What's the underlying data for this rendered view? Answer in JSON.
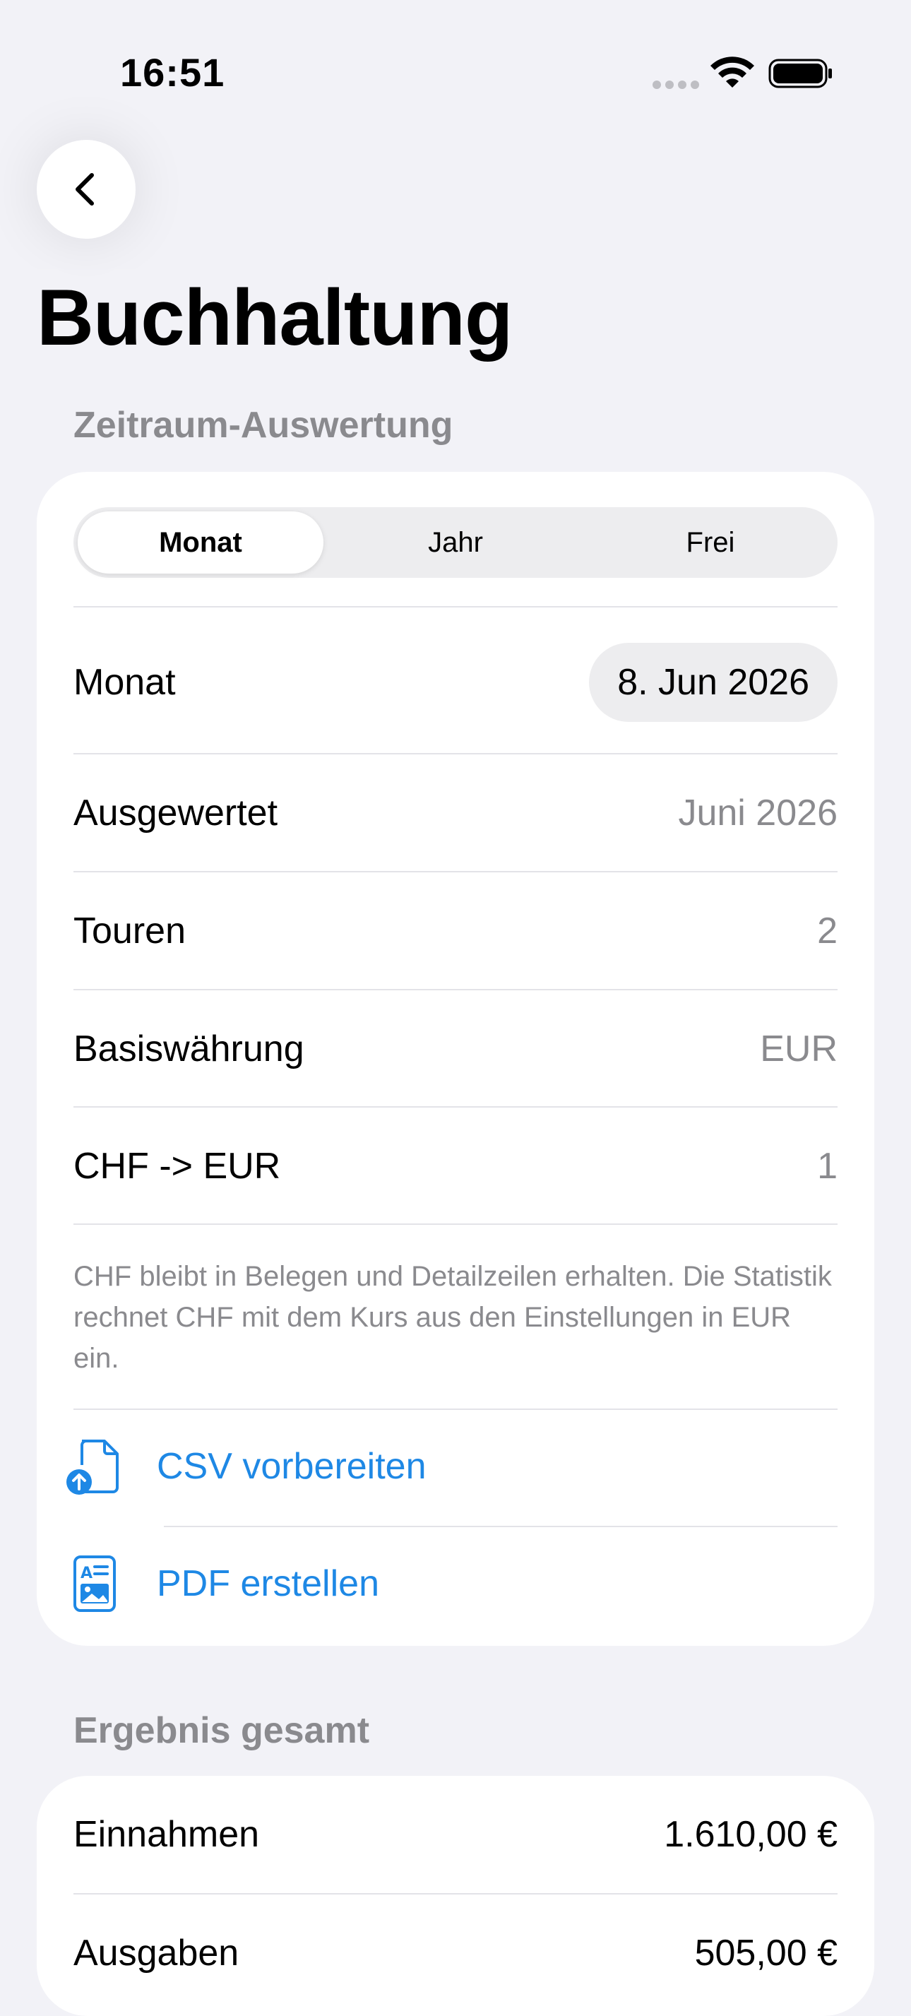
{
  "status_bar": {
    "time": "16:51"
  },
  "nav": {
    "title": "Buchhaltung"
  },
  "period_section": {
    "header": "Zeitraum-Auswertung",
    "segments": [
      "Monat",
      "Jahr",
      "Frei"
    ],
    "selected_segment": "Monat",
    "rows": {
      "month_label": "Monat",
      "month_value": "8. Jun 2026",
      "evaluated_label": "Ausgewertet",
      "evaluated_value": "Juni 2026",
      "tours_label": "Touren",
      "tours_value": "2",
      "base_currency_label": "Basiswährung",
      "base_currency_value": "EUR",
      "rate_label": "CHF -> EUR",
      "rate_value": "1"
    },
    "note": "CHF bleibt in Belegen und Detailzeilen erhalten. Die Statistik rechnet CHF mit dem Kurs aus den Einstellungen in EUR ein.",
    "actions": {
      "csv_label": "CSV vorbereiten",
      "pdf_label": "PDF erstellen"
    }
  },
  "result_section": {
    "header": "Ergebnis gesamt",
    "income_label": "Einnahmen",
    "income_value": "1.610,00 €",
    "expenses_label": "Ausgaben",
    "expenses_value": "505,00 €"
  },
  "colors": {
    "background": "#F2F2F7",
    "card": "#FFFFFF",
    "accent": "#1E88E5",
    "secondary_text": "#8A8A8E"
  },
  "icons": {
    "back": "chevron-left-icon",
    "csv": "document-upload-icon",
    "pdf": "document-image-icon"
  }
}
